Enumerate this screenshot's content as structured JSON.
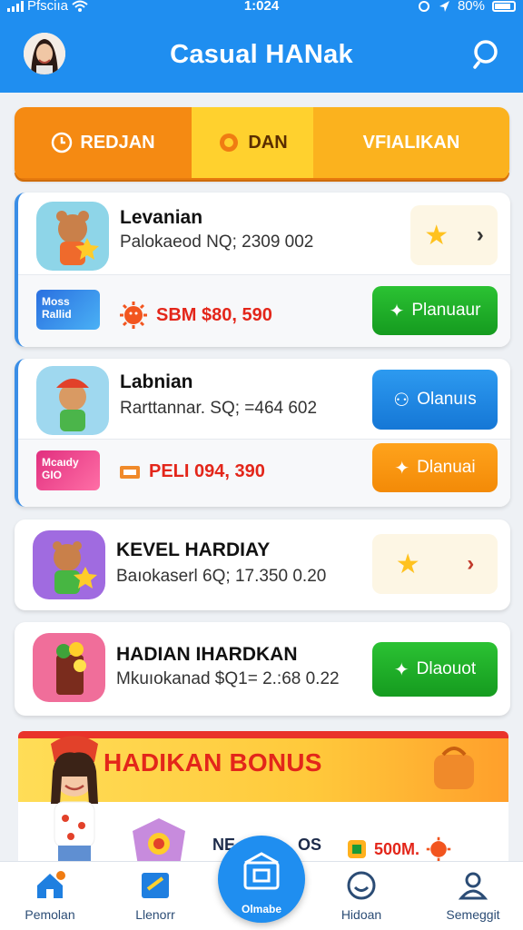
{
  "status_bar": {
    "carrier": "Pfsciıa",
    "time": "1:024",
    "battery": "80%"
  },
  "header": {
    "title": "Casual HANak"
  },
  "tabs": [
    {
      "label": "REDJAN",
      "icon": "clock-icon"
    },
    {
      "label": "DAN",
      "icon": "sun-icon"
    },
    {
      "label": "VFIALIKAN",
      "icon": "none"
    }
  ],
  "cards": [
    {
      "name": "Levanian",
      "subtitle": "Palokaeod NQ; 2309 002",
      "badge_text": "Moss Rallid",
      "prize": "SBM $80, 590",
      "button": "Planuaur",
      "side": "star"
    },
    {
      "name": "Labnian",
      "subtitle": "Rarttannar. SQ; =464 602",
      "badge_text": "Mcaıdy GIO",
      "prize": "PELI 094, 390",
      "top_button": "Olanuıs",
      "button": "Dlanuai"
    },
    {
      "name": "KEVEL HARDIAY",
      "subtitle": "Baıokaserl 6Q; 17.350 0.20",
      "side": "star"
    },
    {
      "name": "HADIAN IHARDKAN",
      "subtitle": "Mkuıokanad $Q1= 2.:68 0.22",
      "button": "Dlaouot"
    }
  ],
  "bonus": {
    "title": "HADIKAN BONUS",
    "row_left": "NE",
    "row_mid": "OS",
    "row_amount": "500M."
  },
  "bottom_nav": [
    {
      "label": "Pemolan",
      "icon": "home-icon"
    },
    {
      "label": "Llenorr",
      "icon": "news-icon"
    },
    {
      "label": "Olmabe",
      "icon": "store-icon"
    },
    {
      "label": "Hidoan",
      "icon": "smile-icon"
    },
    {
      "label": "Semeggit",
      "icon": "profile-icon"
    }
  ],
  "colors": {
    "primary": "#1f8ef0",
    "green": "#1fb02a",
    "orange": "#f58a12",
    "red": "#e3261a"
  }
}
